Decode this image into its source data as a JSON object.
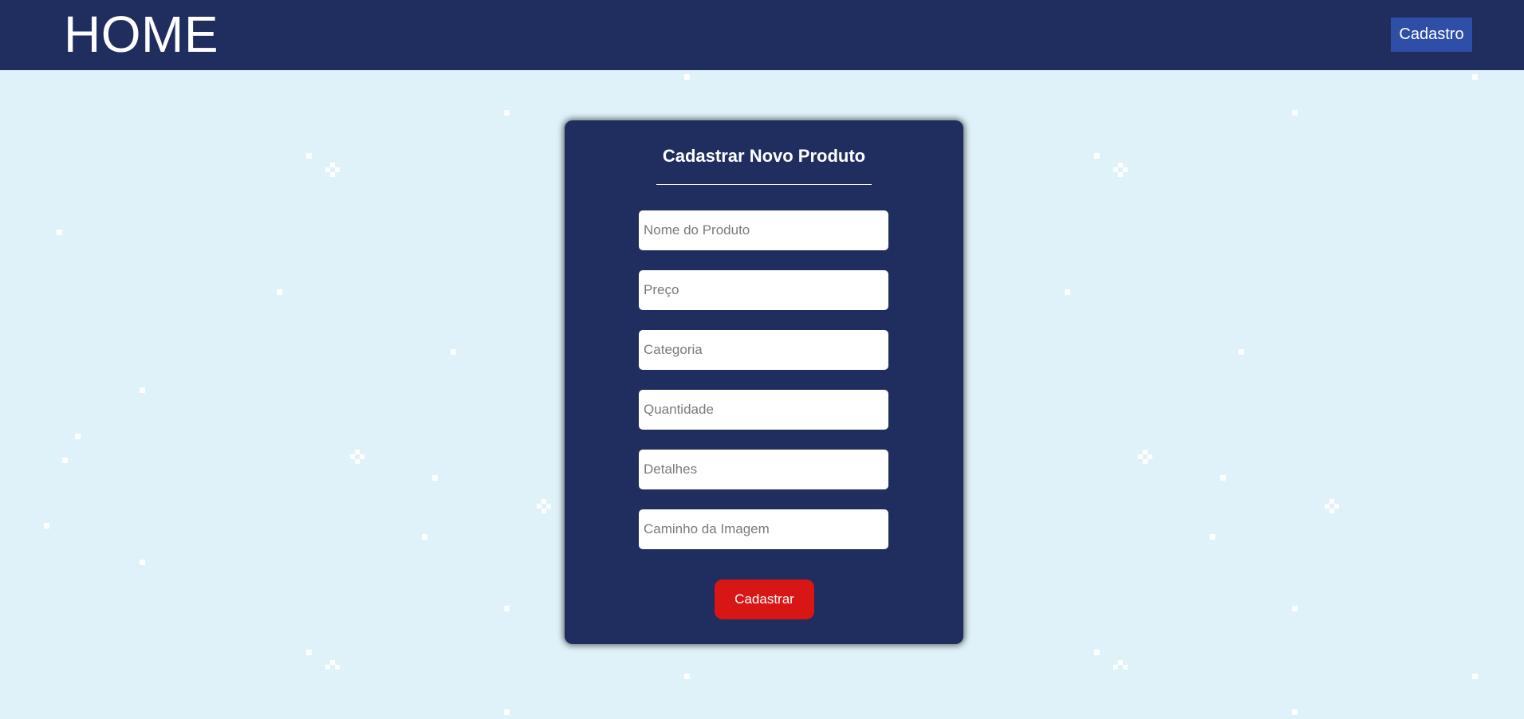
{
  "header": {
    "title": "HOME",
    "nav_button_label": "Cadastro",
    "background_color": "#1f2d5f",
    "button_color": "#2f4ea8"
  },
  "page": {
    "background_color": "#dff2f9"
  },
  "form": {
    "title": "Cadastrar Novo Produto",
    "fields": [
      {
        "placeholder": "Nome do Produto",
        "value": ""
      },
      {
        "placeholder": "Preço",
        "value": ""
      },
      {
        "placeholder": "Categoria",
        "value": ""
      },
      {
        "placeholder": "Quantidade",
        "value": ""
      },
      {
        "placeholder": "Detalhes",
        "value": ""
      },
      {
        "placeholder": "Caminho da Imagem",
        "value": ""
      }
    ],
    "submit_label": "Cadastrar",
    "card_color": "#1f2d5f",
    "submit_color": "#d91616"
  }
}
